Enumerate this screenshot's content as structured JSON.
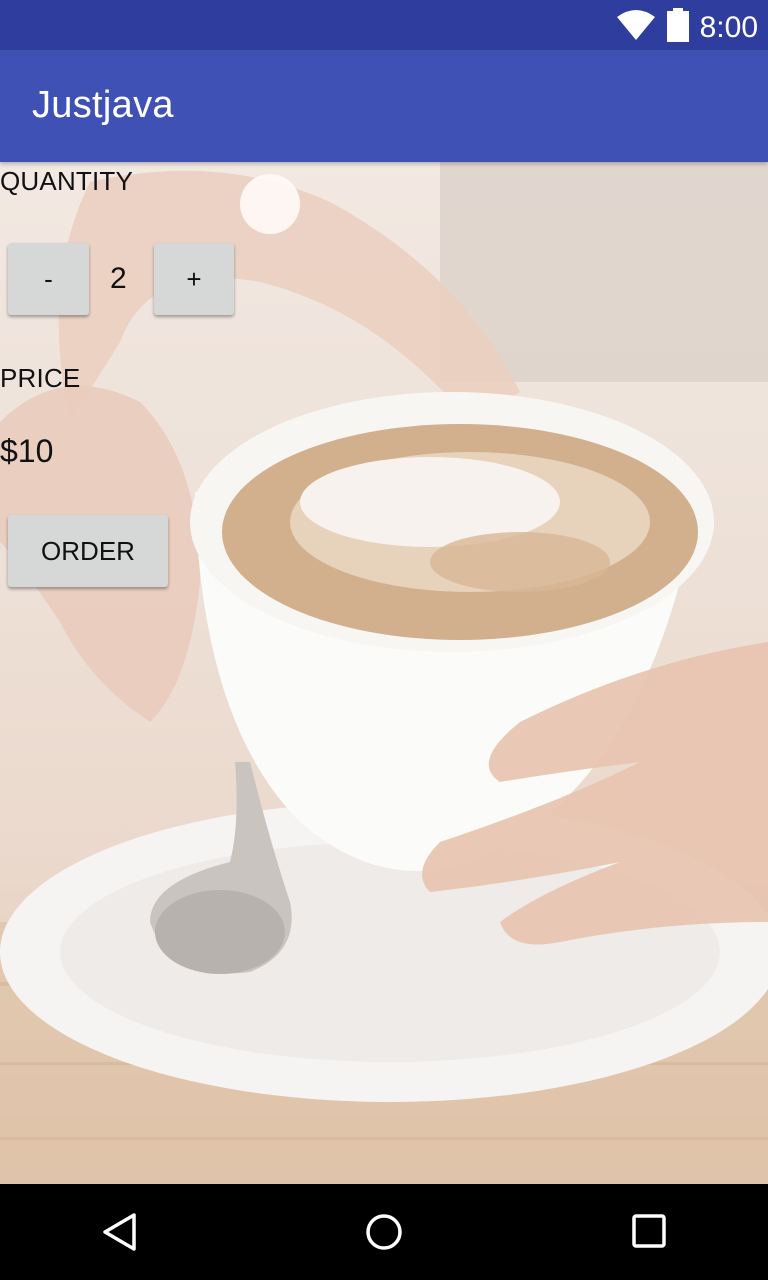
{
  "status_bar": {
    "time": "8:00",
    "color": "#2f3e9e"
  },
  "app_bar": {
    "title": "Justjava",
    "color": "#3f51b5"
  },
  "main": {
    "quantity_label": "QUANTITY",
    "decrement_label": "-",
    "quantity_value": "2",
    "increment_label": "+",
    "price_label": "PRICE",
    "price_value": "$10",
    "order_label": "ORDER"
  },
  "nav_bar": {
    "items": [
      "back-icon",
      "home-icon",
      "recents-icon"
    ]
  }
}
